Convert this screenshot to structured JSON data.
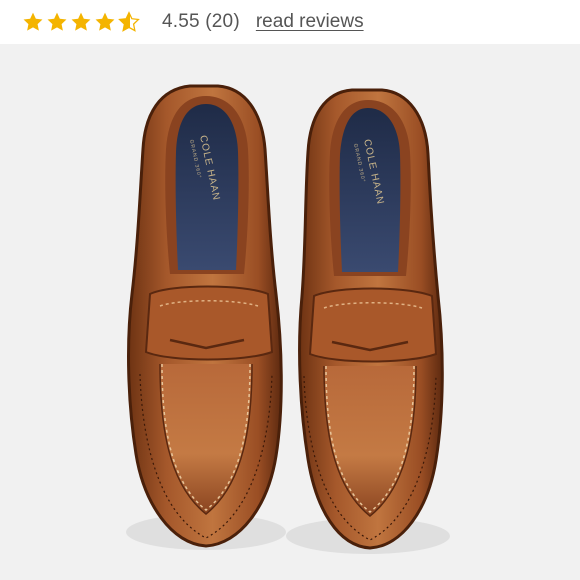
{
  "rating": {
    "value_text": "4.55 (20)",
    "stars_filled": 4,
    "stars_fraction": 0.55,
    "star_color": "#f4b400",
    "star_empty_color": "#d8d8d8",
    "link_label": "read reviews"
  },
  "product": {
    "image_alt": "Pair of brown leather penny loafers viewed from above",
    "insole_brand": "COLE HAAN",
    "insole_sub": "GRAND.360°"
  },
  "colors": {
    "leather": "#a2552a",
    "insole": "#2c3a5c",
    "background": "#f1f1f1"
  }
}
